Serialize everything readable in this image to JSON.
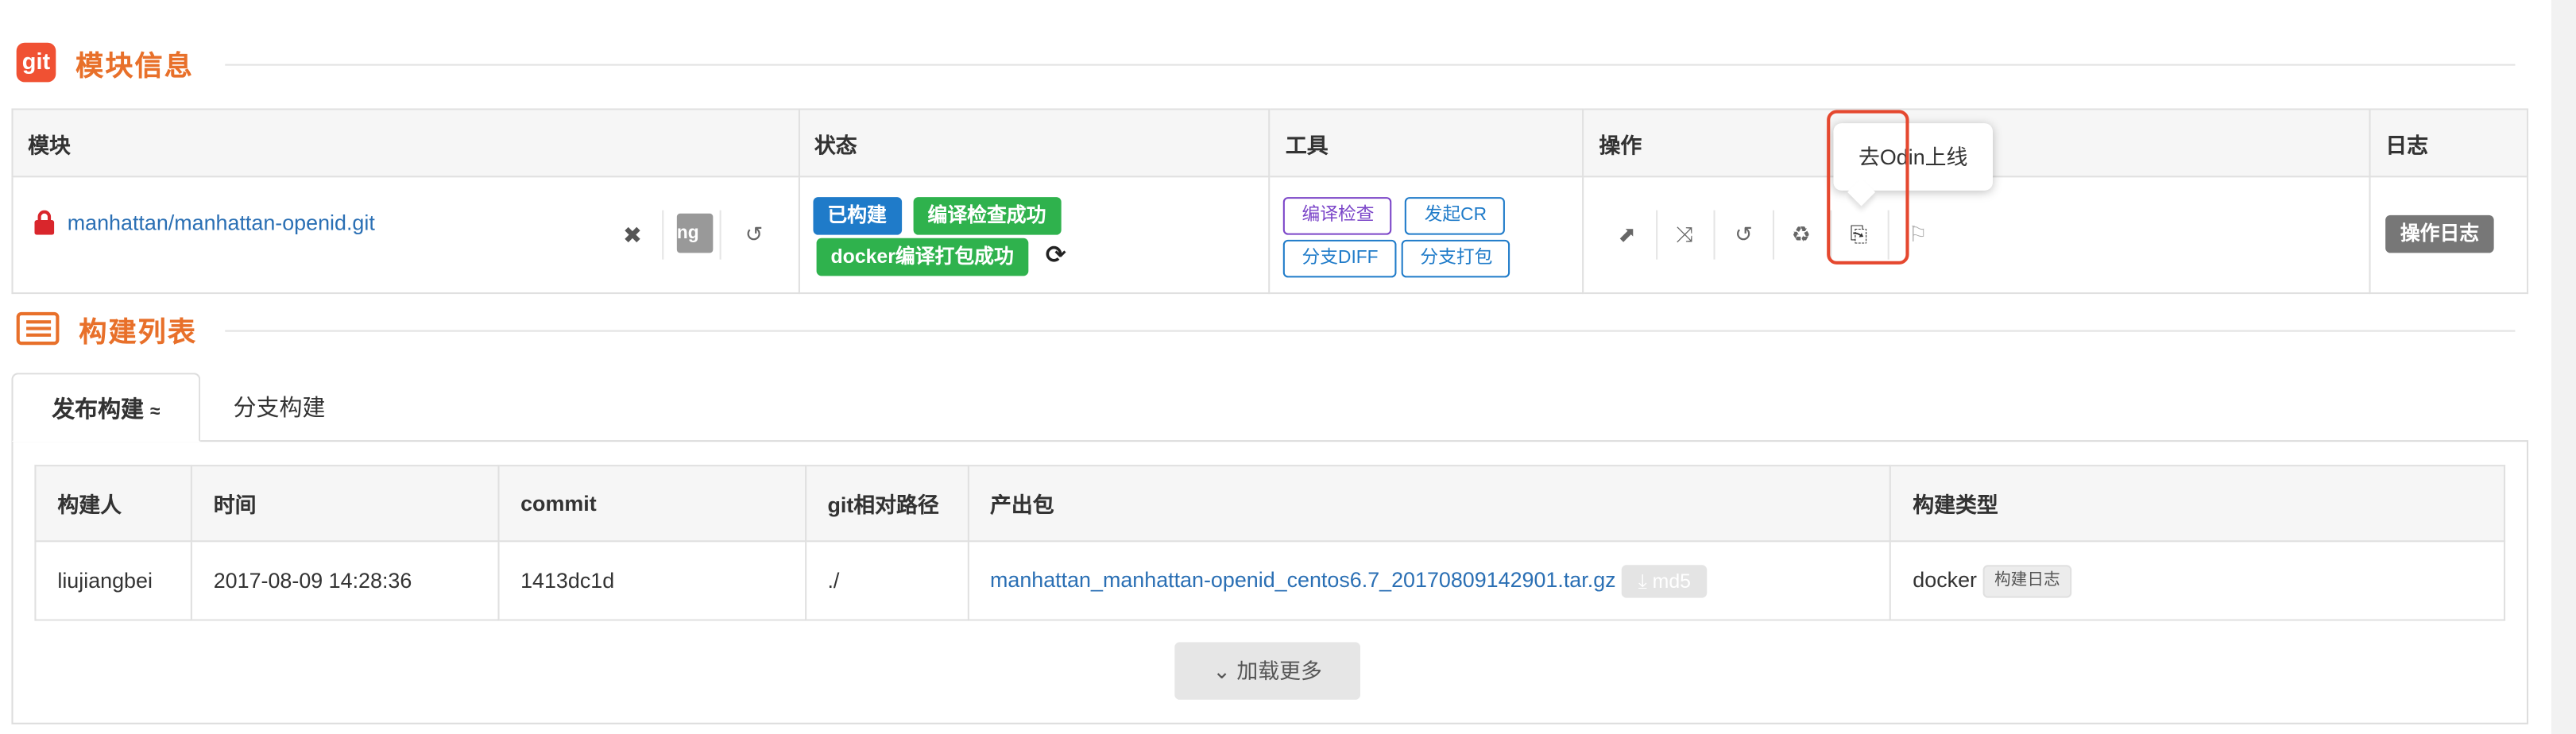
{
  "module_section": {
    "icon_text": "git",
    "title": "模块信息"
  },
  "module_table": {
    "headers": [
      "模块",
      "状态",
      "工具",
      "操作",
      "日志"
    ],
    "row": {
      "repo": "manhattan/manhattan-openid.git",
      "partial_text": "ng F",
      "status": {
        "built": "已构建",
        "check_ok": "编译检查成功",
        "docker_ok": "docker编译打包成功"
      },
      "tools": {
        "compile_check": "编译检查",
        "start_cr": "发起CR",
        "branch_diff": "分支DIFF",
        "branch_pack": "分支打包"
      },
      "log_button": "操作日志"
    }
  },
  "tooltip": "去Odin上线",
  "build_section": {
    "title": "构建列表"
  },
  "tabs": [
    {
      "label": "发布构建",
      "suffix": "≈",
      "active": true
    },
    {
      "label": "分支构建",
      "active": false
    }
  ],
  "build_table": {
    "headers": [
      "构建人",
      "时间",
      "commit",
      "git相对路径",
      "产出包",
      "构建类型"
    ],
    "rows": [
      {
        "builder": "liujiangbei",
        "time": "2017-08-09 14:28:36",
        "commit": "1413dc1d",
        "path": "./",
        "artifact": "manhattan_manhattan-openid_centos6.7_20170809142901.tar.gz",
        "md5": "md5",
        "build_type": "docker",
        "build_log": "构建日志"
      }
    ]
  },
  "load_more": "加载更多",
  "colors": {
    "accent_orange": "#e8702a",
    "git_red": "#f05133",
    "primary_blue": "#1f7bc9",
    "success_green": "#2fb24d",
    "link_blue": "#2a6fb4",
    "purple": "#7b45c8",
    "highlight_red": "#e5482f",
    "lock_red": "#d9262c",
    "log_button_grey": "#777777"
  }
}
